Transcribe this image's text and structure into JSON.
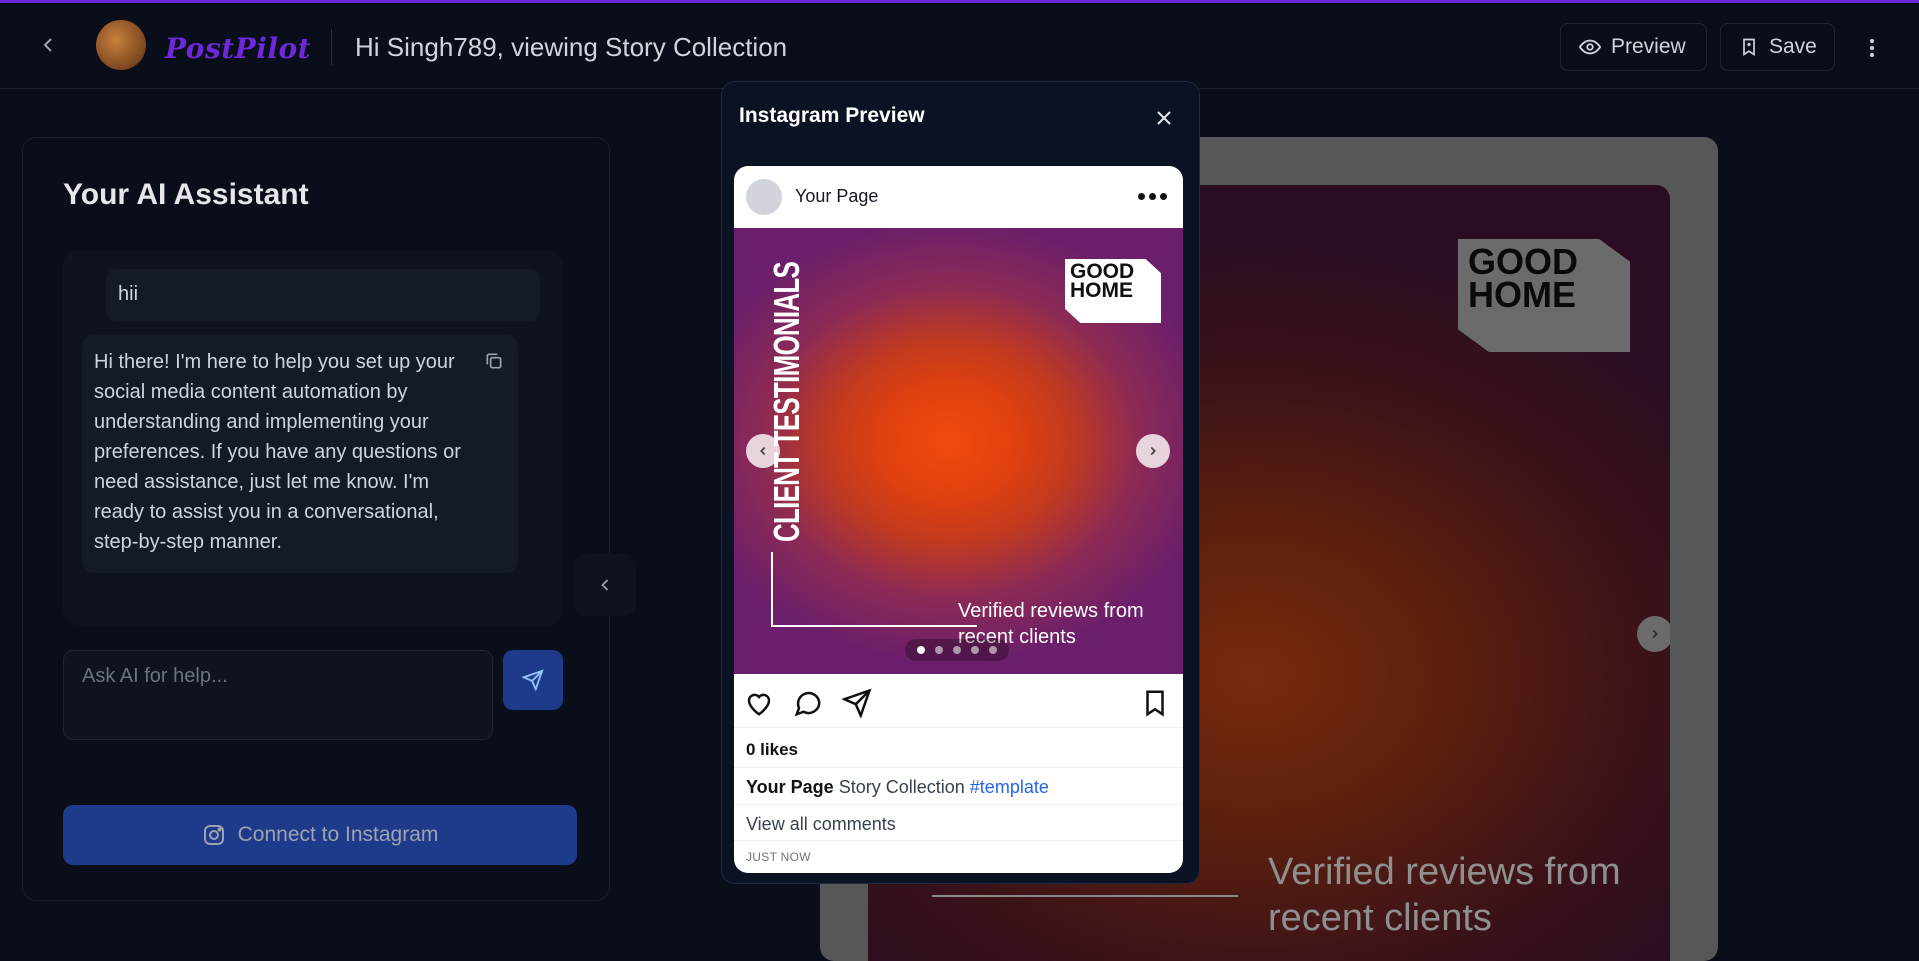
{
  "header": {
    "back_icon": "chevron-left-icon",
    "logo_text": "PostPilot",
    "title": "Hi Singh789, viewing Story Collection",
    "preview_label": "Preview",
    "save_label": "Save",
    "menu_icon": "kebab-icon",
    "accent": "#6d28d9"
  },
  "assistant": {
    "title": "Your AI Assistant",
    "user_message": "hii",
    "ai_message": "Hi there! I'm here to help you set up your social media content automation by understanding and implementing your preferences. If you have any questions or need assistance, just let me know. I'm ready to assist you in a conversational, step-by-step manner.",
    "input_placeholder": "Ask AI for help...",
    "connect_label": "Connect to Instagram",
    "button_color": "#1e3a8a"
  },
  "canvas": {
    "logo_text": "GOOD HOME",
    "caption": "Verified reviews from recent clients"
  },
  "modal": {
    "title": "Instagram Preview",
    "post": {
      "page_name": "Your Page",
      "slide_vertical_text": "CLIENT TESTIMONIALS",
      "slide_logo": "GOOD HOME",
      "slide_caption": "Verified reviews from recent clients",
      "slide_count": 5,
      "active_slide": 1,
      "likes": "0 likes",
      "caption_user": "Your Page",
      "caption_text": "Story Collection",
      "caption_tag": "#template",
      "view_comments": "View all comments",
      "time": "JUST NOW",
      "tag_color": "#2563eb"
    }
  }
}
